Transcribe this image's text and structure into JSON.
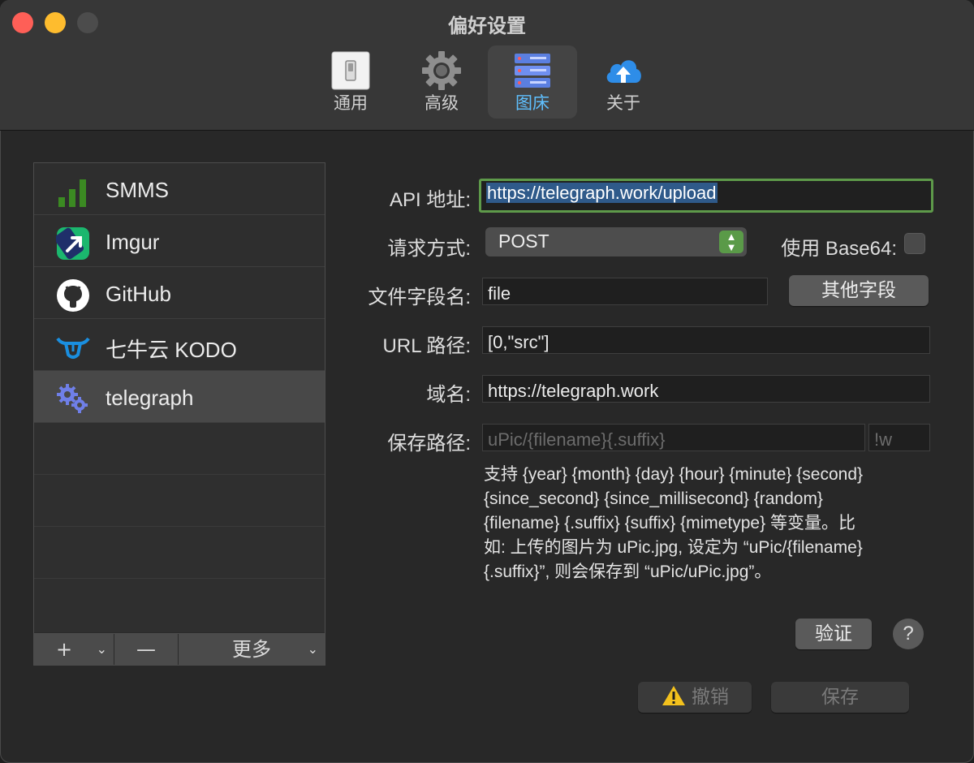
{
  "window": {
    "title": "偏好设置"
  },
  "toolbar": {
    "tabs": [
      {
        "label": "通用",
        "icon": "switch-icon"
      },
      {
        "label": "高级",
        "icon": "gear-icon"
      },
      {
        "label": "图床",
        "icon": "server-rack-icon",
        "active": true
      },
      {
        "label": "关于",
        "icon": "cloud-upload-icon"
      }
    ]
  },
  "sidebar": {
    "hosts": [
      {
        "label": "SMMS",
        "icon": "signal-bars-icon"
      },
      {
        "label": "Imgur",
        "icon": "imgur-arrow-icon"
      },
      {
        "label": "GitHub",
        "icon": "github-icon"
      },
      {
        "label": "七牛云 KODO",
        "icon": "qiniu-icon"
      },
      {
        "label": "telegraph",
        "icon": "gears-icon",
        "selected": true
      }
    ],
    "add_label": "+",
    "remove_label": "—",
    "more_label": "更多"
  },
  "form": {
    "api_label": "API 地址:",
    "api_value": "https://telegraph.work/upload",
    "method_label": "请求方式:",
    "method_value": "POST",
    "base64_label": "使用 Base64:",
    "base64_checked": false,
    "field_name_label": "文件字段名:",
    "field_name_value": "file",
    "other_fields_button": "其他字段",
    "url_path_label": "URL 路径:",
    "url_path_value": "[0,\"src\"]",
    "domain_label": "域名:",
    "domain_value": "https://telegraph.work",
    "save_path_label": "保存路径:",
    "save_path_placeholder": "uPic/{filename}{.suffix}",
    "suffix_placeholder": "!w",
    "hint_lines": [
      "支持 {year} {month} {day} {hour} {minute} {second}",
      "{since_second} {since_millisecond} {random}",
      "{filename} {.suffix} {suffix} {mimetype} 等变量。比",
      "如: 上传的图片为 uPic.jpg, 设定为 “uPic/{filename}",
      "{.suffix}”, 则会保存到 “uPic/uPic.jpg”。"
    ]
  },
  "actions": {
    "verify_label": "验证",
    "help_label": "?",
    "undo_label": "撤销",
    "save_label": "保存"
  },
  "colors": {
    "accent_blue": "#5fc0ff",
    "focus_green": "#5e9a4a",
    "close": "#fe5f57",
    "minimize": "#febc2e"
  }
}
